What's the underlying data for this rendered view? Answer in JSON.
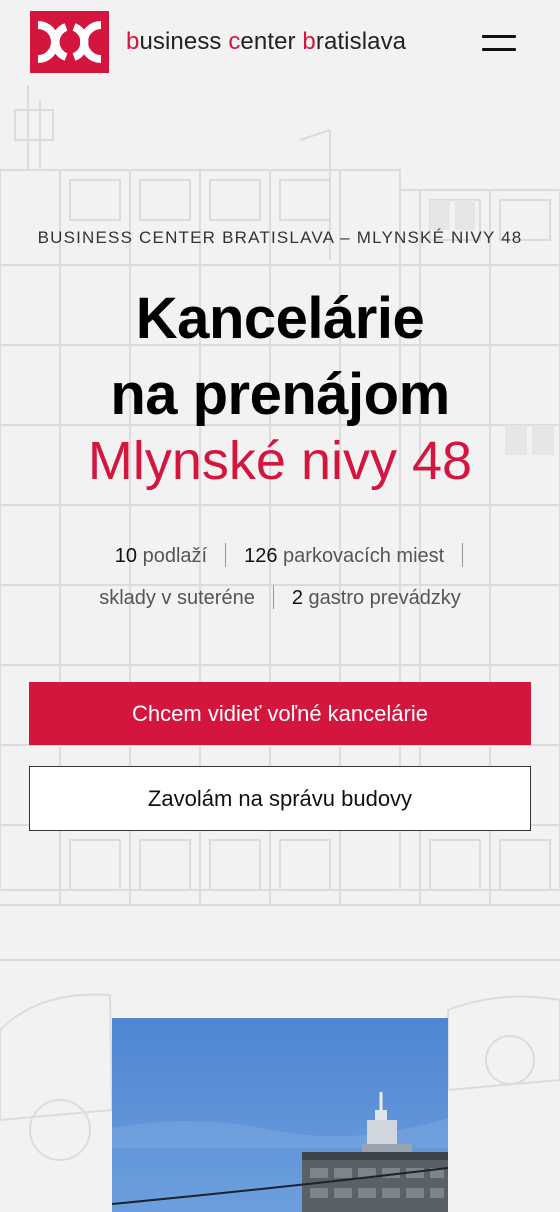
{
  "header": {
    "logo": {
      "icon": "bcb-logo-icon",
      "color": "#d4163f"
    },
    "brand": {
      "w1_first": "b",
      "w1_rest": "usiness",
      "w2_first": "c",
      "w2_rest": "enter",
      "w3_first": "b",
      "w3_rest": "ratislava"
    },
    "menu_icon": "hamburger-menu-icon"
  },
  "hero": {
    "eyebrow": "BUSINESS CENTER BRATISLAVA – MLYNSKÉ NIVY 48",
    "title_line1": "Kancelárie",
    "title_line2": "na prenájom",
    "subtitle": "Mlynské nivy 48",
    "facts": [
      {
        "num": "10",
        "text": "podlaží"
      },
      {
        "num": "126",
        "text": "parkovacích miest"
      },
      {
        "num": "",
        "text": "sklady v suteréne"
      },
      {
        "num": "2",
        "text": "gastro prevádzky"
      }
    ],
    "cta_primary": "Chcem vidieť voľné kancelárie",
    "cta_secondary": "Zavolám na správu budovy"
  },
  "colors": {
    "accent": "#d4163f",
    "background": "#f2f2f2",
    "text": "#111111"
  }
}
